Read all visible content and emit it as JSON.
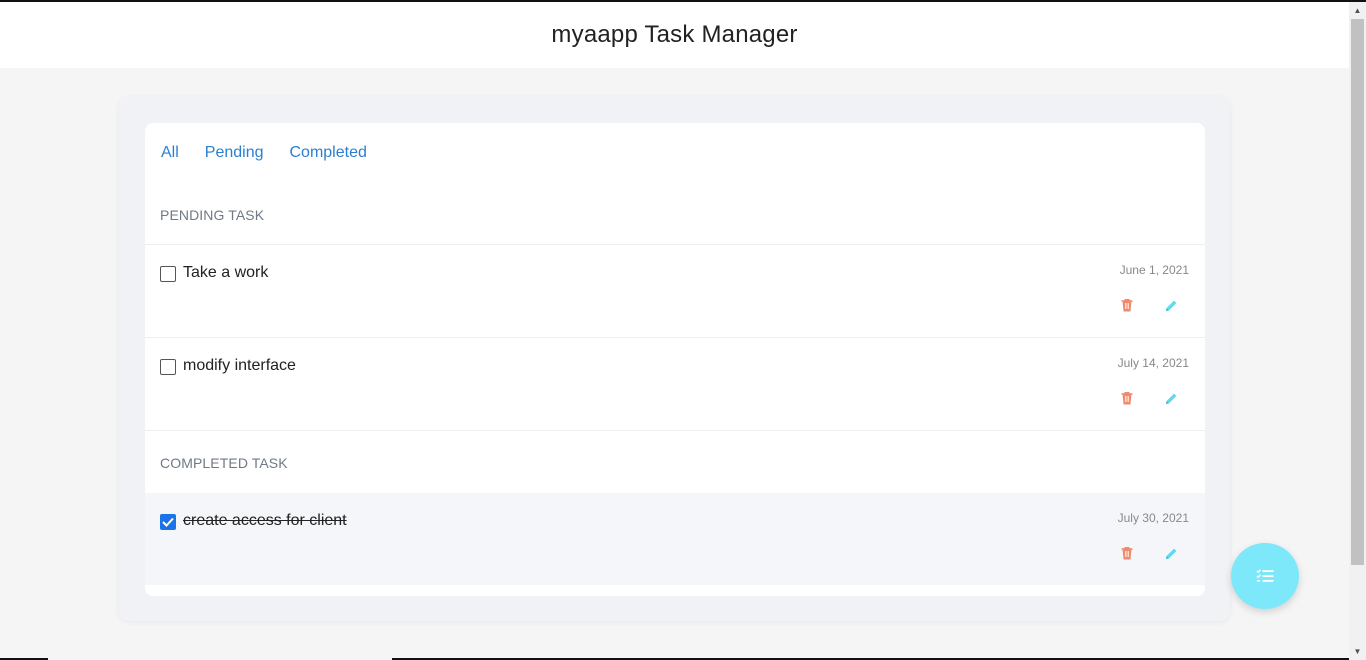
{
  "header": {
    "title": "myaapp Task Manager"
  },
  "tabs": [
    {
      "label": "All"
    },
    {
      "label": "Pending"
    },
    {
      "label": "Completed"
    }
  ],
  "pending": {
    "title": "PENDING TASK",
    "tasks": [
      {
        "text": "Take a work",
        "date": "June 1, 2021",
        "checked": false
      },
      {
        "text": "modify interface",
        "date": "July 14, 2021",
        "checked": false
      }
    ]
  },
  "completed": {
    "title": "COMPLETED TASK",
    "tasks": [
      {
        "text": "create access for client",
        "date": "July 30, 2021",
        "checked": true
      }
    ]
  },
  "icons": {
    "delete": "trash-icon",
    "edit": "pencil-icon",
    "fab": "task-list-icon"
  },
  "colors": {
    "accent": "#2a7fd4",
    "delete": "#f08a6c",
    "edit": "#5fd9f2",
    "fab": "#7ee8fb",
    "checkbox_checked": "#1a73e8"
  }
}
